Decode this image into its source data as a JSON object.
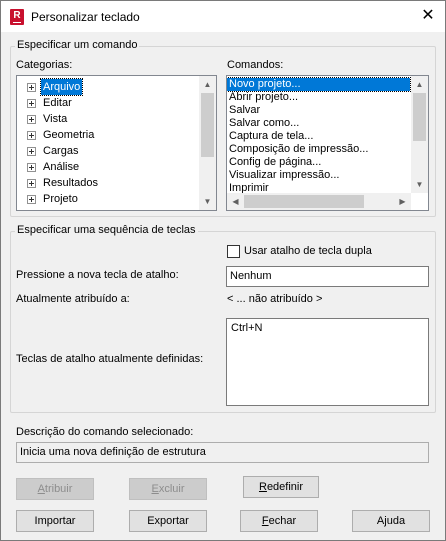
{
  "window": {
    "title": "Personalizar teclado",
    "app_icon_letter": "R"
  },
  "specify_command": {
    "group_label": "Especificar um comando",
    "categories_label": "Categorias:",
    "categories": [
      "Arquivo",
      "Editar",
      "Vista",
      "Geometria",
      "Cargas",
      "Análise",
      "Resultados",
      "Projeto"
    ],
    "selected_category": "Arquivo",
    "commands_label": "Comandos:",
    "commands": [
      "Novo projeto...",
      "Abrir projeto...",
      "Salvar",
      "Salvar como...",
      "Captura de tela...",
      "Composição de impressão...",
      "Config de página...",
      "Visualizar impressão...",
      "Imprimir"
    ],
    "selected_command": "Novo projeto..."
  },
  "key_sequence": {
    "group_label": "Especificar uma sequência de teclas",
    "double_shortcut_label": "Usar atalho de tecla dupla",
    "double_shortcut_checked": false,
    "press_new_key_label": "Pressione a nova tecla de atalho:",
    "press_new_key_value": "Nenhum",
    "currently_assigned_label": "Atualmente atribuído a:",
    "currently_assigned_value": "< ... não atribuído >",
    "defined_keys_label": "Teclas de atalho atualmente definidas:",
    "defined_keys": [
      "Ctrl+N"
    ]
  },
  "description": {
    "label": "Descrição do comando selecionado:",
    "value": "Inicia uma nova definição de estrutura"
  },
  "buttons": {
    "assign": {
      "pre": "",
      "key": "A",
      "post": "tribuir"
    },
    "delete": {
      "pre": "",
      "key": "E",
      "post": "xcluir"
    },
    "reset": {
      "pre": "",
      "key": "R",
      "post": "edefinir"
    },
    "import": "Importar",
    "export": "Exportar",
    "close": {
      "pre": "",
      "key": "F",
      "post": "echar"
    },
    "help": "Ajuda"
  }
}
